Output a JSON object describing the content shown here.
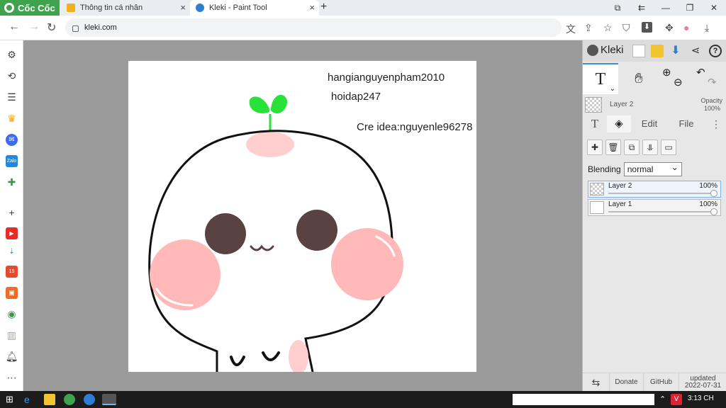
{
  "browser": {
    "brand": "Cốc Cốc",
    "tabs": [
      {
        "title": "Thông tin cá nhân",
        "favicon_color": "#f2b01e"
      },
      {
        "title": "Kleki - Paint Tool",
        "favicon_color": "#2e7dd1"
      }
    ],
    "url": "kleki.com"
  },
  "canvas": {
    "texts": [
      "hangianguyenpham2010",
      "hoidap247",
      "Cre idea:nguyenle96278"
    ],
    "colors": {
      "outline": "#111111",
      "cheek": "#ffb9b9",
      "eye": "#5b4242",
      "sprout": "#28e23a",
      "tint": "#ffcfd0"
    }
  },
  "kleki": {
    "logo": "Kleki",
    "current_layer": "Layer 2",
    "opacity_label": "Opacity",
    "opacity_value": "100%",
    "tabs": [
      "Edit",
      "File"
    ],
    "blending_label": "Blending",
    "blending_value": "normal",
    "layers": [
      {
        "name": "Layer 2",
        "opacity": "100%",
        "selected": true
      },
      {
        "name": "Layer 1",
        "opacity": "100%",
        "selected": false
      }
    ],
    "footer": {
      "donate": "Donate",
      "github": "GitHub",
      "updated_label": "updated",
      "updated_date": "2022-07-31"
    }
  },
  "taskbar": {
    "time": "3:13 CH"
  },
  "accent": "#3d8fd6"
}
